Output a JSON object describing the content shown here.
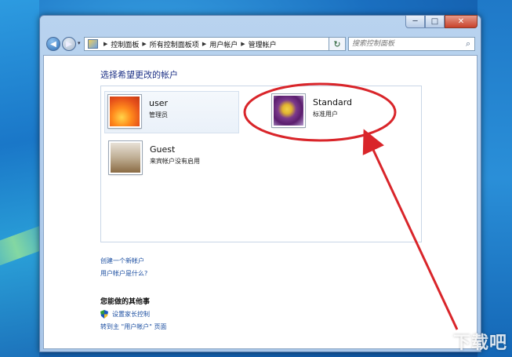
{
  "window": {
    "controls": {
      "minimize": "─",
      "maximize": "□",
      "close": "✕"
    }
  },
  "navbar": {
    "back": "◀",
    "forward": "▶",
    "breadcrumb": [
      "控制面板",
      "所有控制面板项",
      "用户帐户",
      "管理帐户"
    ],
    "refresh": "↻",
    "search_placeholder": "搜索控制面板"
  },
  "content": {
    "heading": "选择希望更改的帐户",
    "accounts": [
      {
        "name": "user",
        "role": "管理员"
      },
      {
        "name": "Standard",
        "role": "标准用户"
      },
      {
        "name": "Guest",
        "role": "来宾帐户没有启用"
      }
    ],
    "links": [
      "创建一个新帐户",
      "用户帐户是什么?"
    ],
    "other_heading": "您能做的其他事",
    "tasks": [
      "设置家长控制",
      "转到主 \"用户帐户\" 页面"
    ]
  },
  "watermark": "下载吧",
  "colors": {
    "annotation": "#d9252a",
    "link": "#1e50a2",
    "heading": "#1e3287"
  }
}
